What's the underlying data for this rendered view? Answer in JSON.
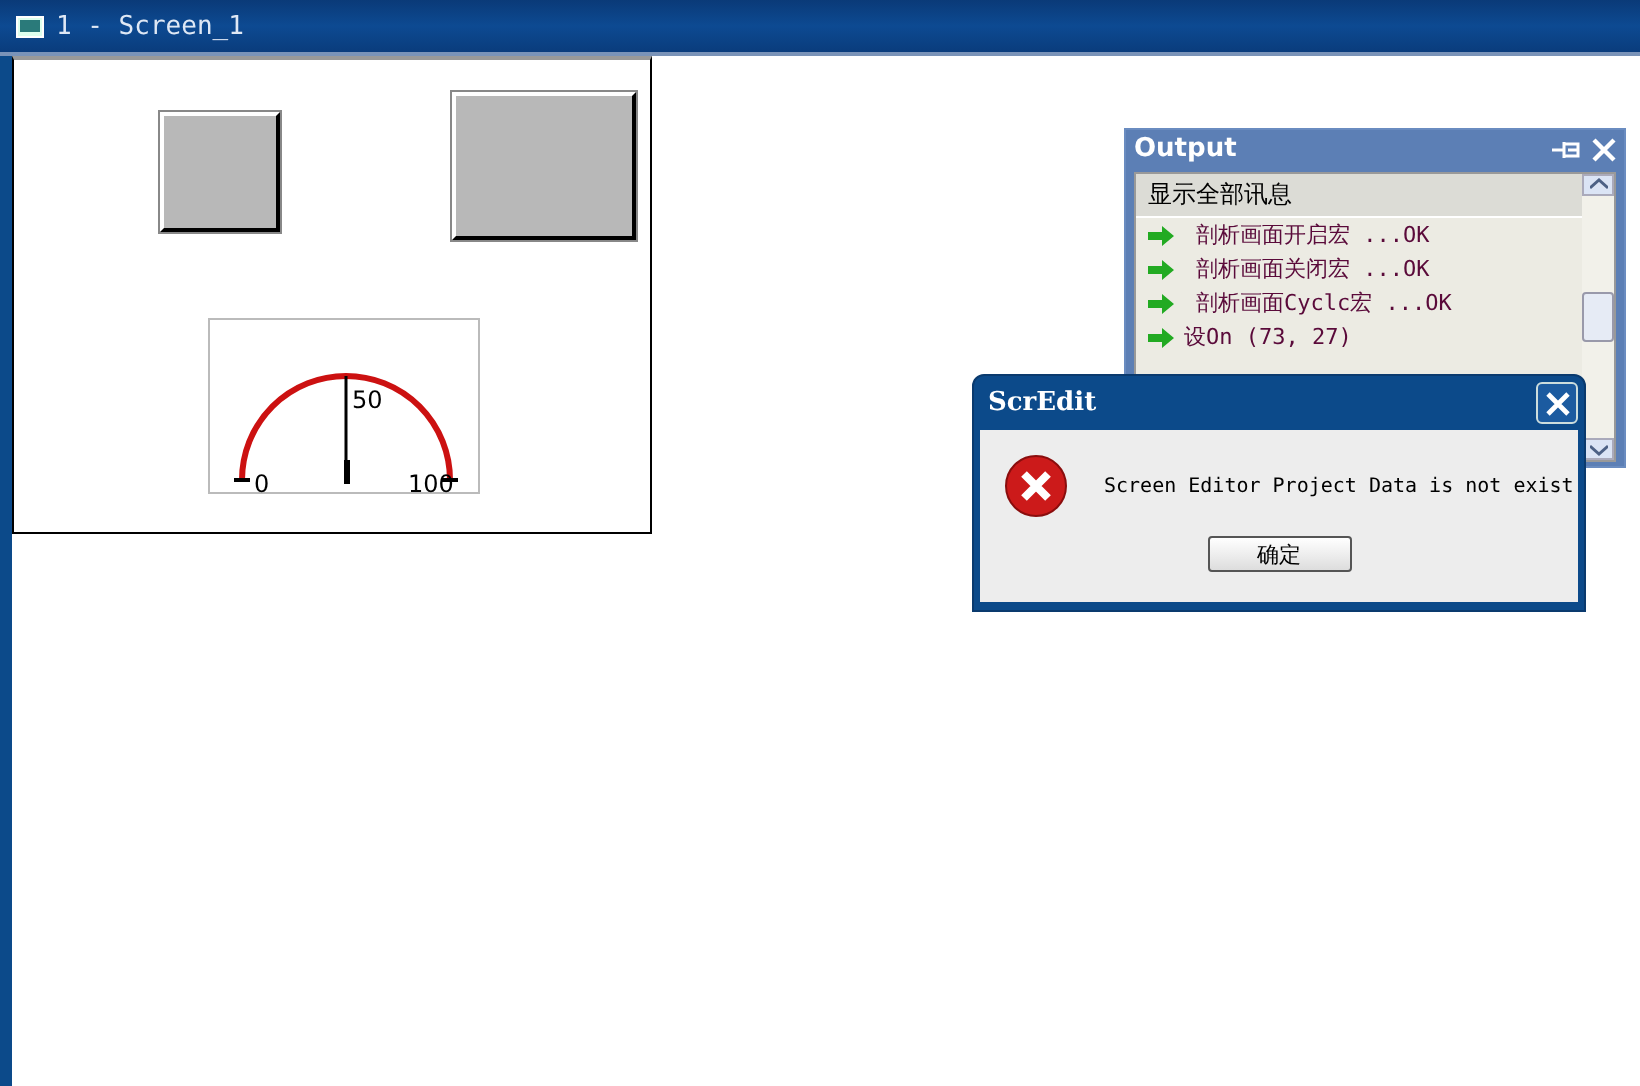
{
  "window": {
    "title": "1 - Screen_1"
  },
  "canvas": {
    "gauge": {
      "labels": [
        "0",
        "50",
        "100"
      ]
    }
  },
  "output": {
    "title": "Output",
    "header": "显示全部讯息",
    "messages": [
      "剖析画面开启宏 ...OK",
      "剖析画面关闭宏 ...OK",
      "剖析画面Cyclc宏 ...OK",
      "设On (73, 27)"
    ]
  },
  "dialog": {
    "title": "ScrEdit",
    "message": "Screen Editor Project Data is not exist",
    "button": "确定"
  }
}
